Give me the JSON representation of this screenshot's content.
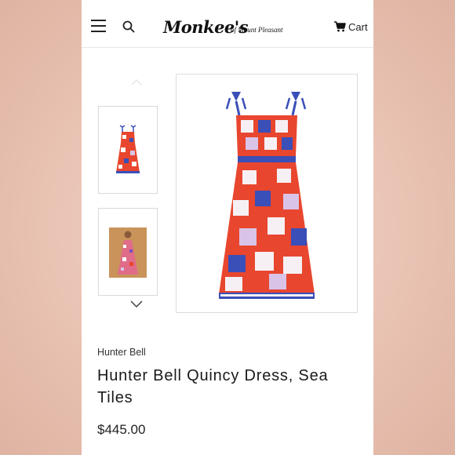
{
  "header": {
    "logo_main": "Monkee's",
    "logo_sub": "of Mount Pleasant",
    "cart_label": "Cart"
  },
  "product": {
    "brand": "Hunter Bell",
    "title": "Hunter Bell Quincy Dress, Sea Tiles",
    "price": "$445.00"
  },
  "icons": [
    "menu-icon",
    "search-icon",
    "cart-icon",
    "chevron-up-icon",
    "chevron-down-icon"
  ],
  "colors": {
    "dress_red": "#e8462e",
    "dress_blue": "#3a4fb8",
    "text": "#1a1a1a"
  }
}
